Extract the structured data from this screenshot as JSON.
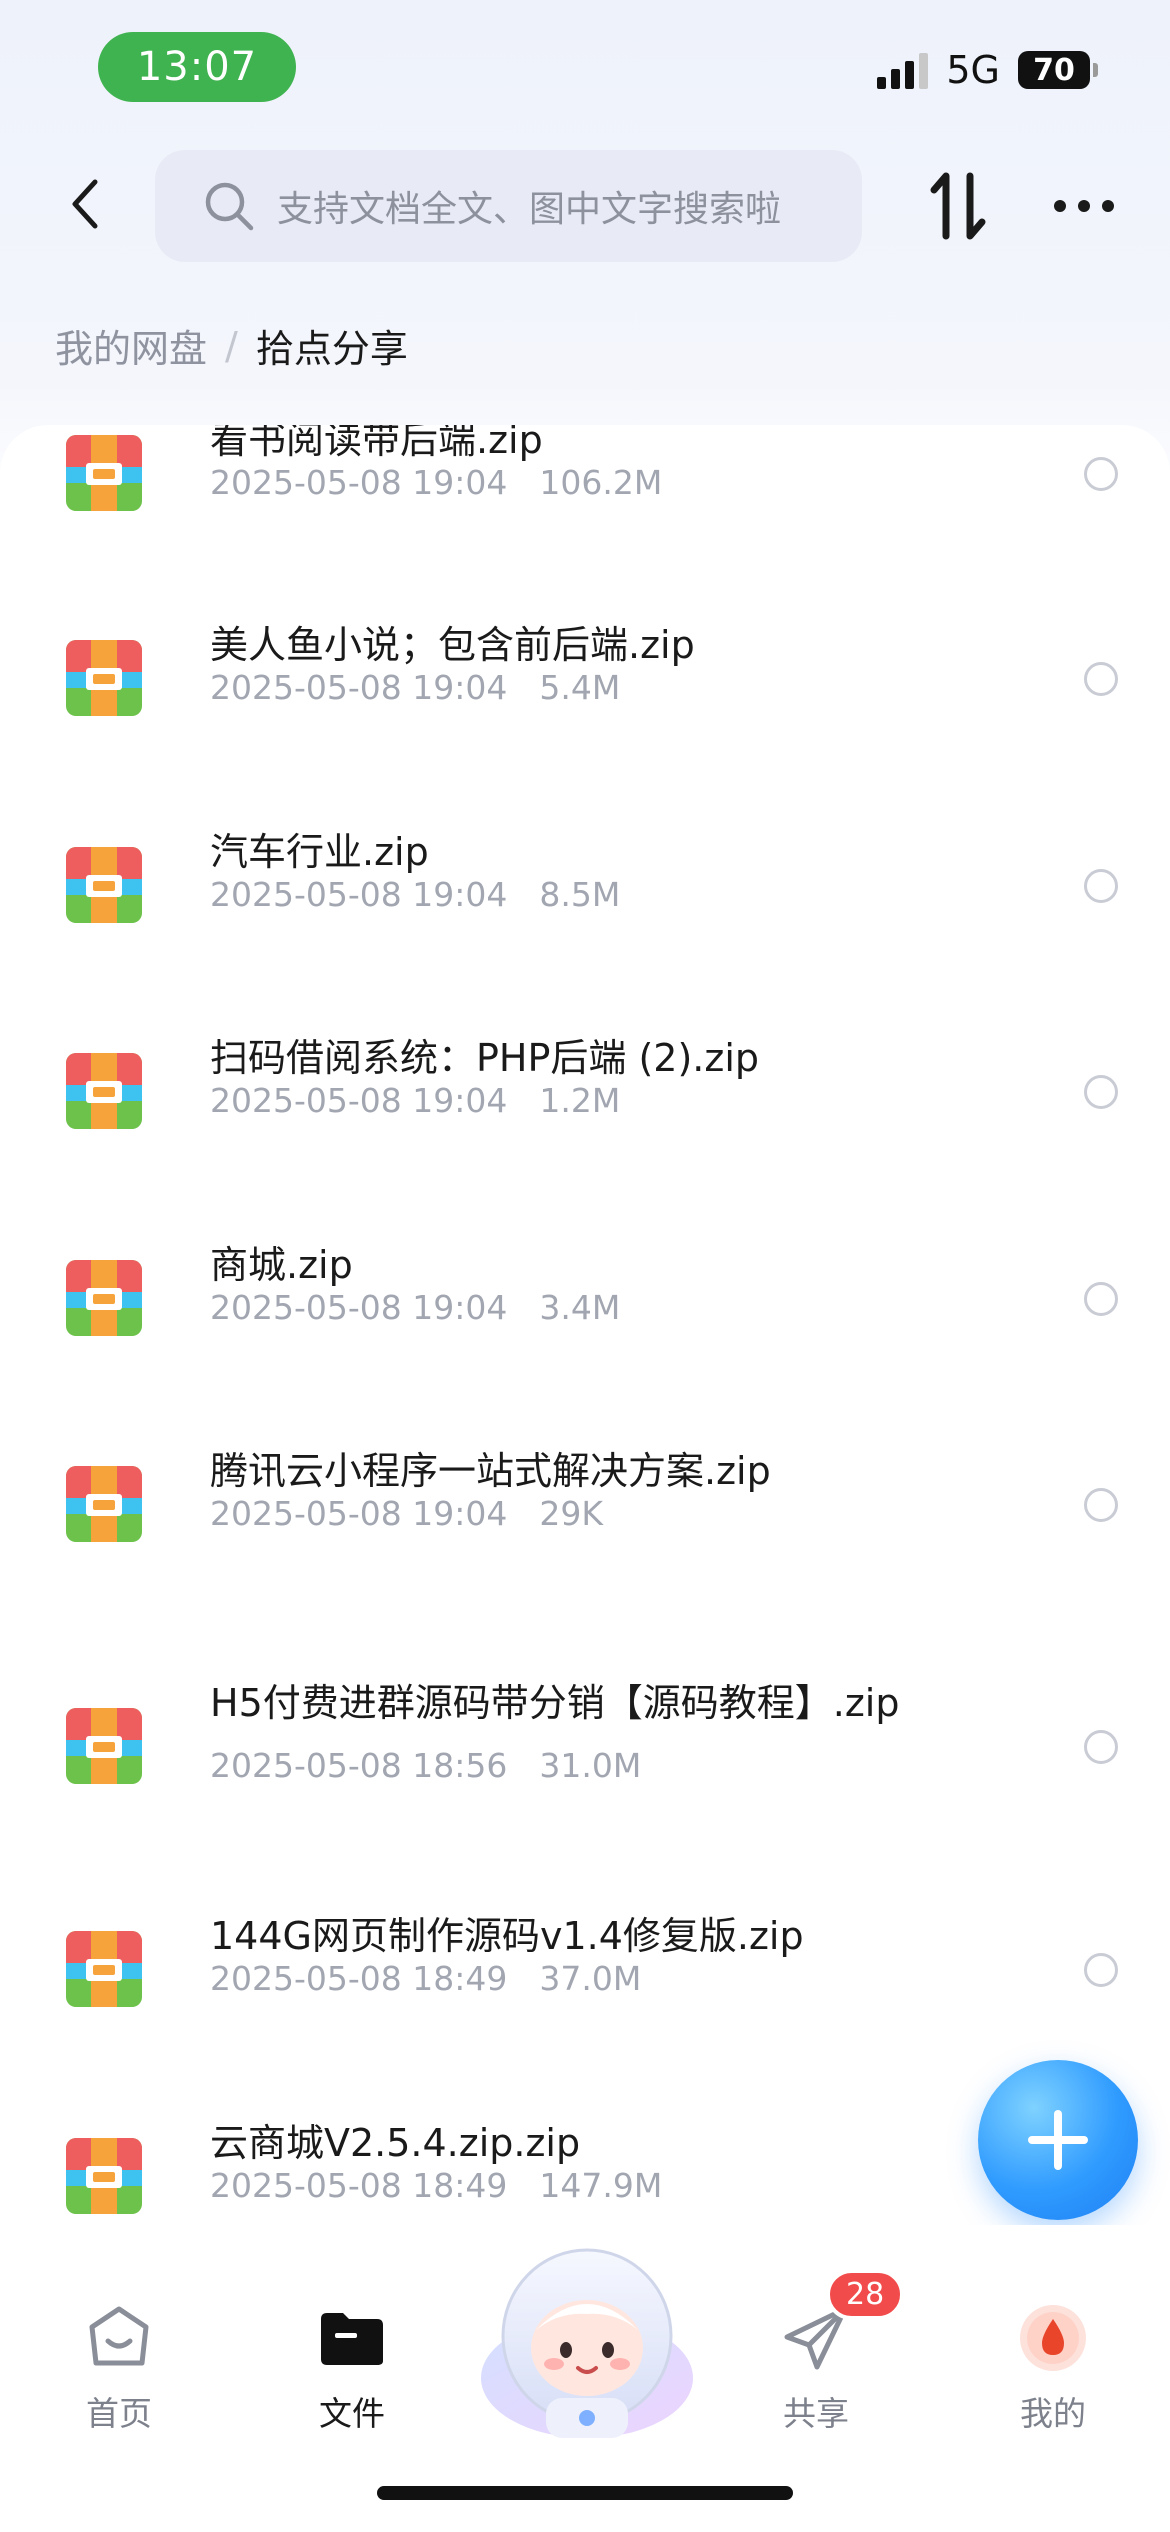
{
  "status_bar": {
    "time": "13:07",
    "network": "5G",
    "battery": "70"
  },
  "header": {
    "search_placeholder": "支持文档全文、图中文字搜索啦"
  },
  "breadcrumb": {
    "root": "我的网盘",
    "separator": "/",
    "current": "拾点分享"
  },
  "files": [
    {
      "name": "看书阅读带后端.zip",
      "date": "2025-05-08 19:04",
      "size": "106.2M"
    },
    {
      "name": "美人鱼小说；包含前后端.zip",
      "date": "2025-05-08 19:04",
      "size": "5.4M"
    },
    {
      "name": "汽车行业.zip",
      "date": "2025-05-08 19:04",
      "size": "8.5M"
    },
    {
      "name": "扫码借阅系统：PHP后端 (2).zip",
      "date": "2025-05-08 19:04",
      "size": "1.2M"
    },
    {
      "name": "商城.zip",
      "date": "2025-05-08 19:04",
      "size": "3.4M"
    },
    {
      "name": "腾讯云小程序一站式解决方案.zip",
      "date": "2025-05-08 19:04",
      "size": "29K"
    },
    {
      "name": "H5付费进群源码带分销【源码教程】.zip",
      "date": "2025-05-08 18:56",
      "size": "31.0M"
    },
    {
      "name": "144G网页制作源码v1.4修复版.zip",
      "date": "2025-05-08 18:49",
      "size": "37.0M"
    },
    {
      "name": "云商城V2.5.4.zip.zip",
      "date": "2025-05-08 18:49",
      "size": "147.9M"
    }
  ],
  "tabbar": {
    "home": "首页",
    "files": "文件",
    "share": "共享",
    "share_badge": "28",
    "me": "我的"
  },
  "colors": {
    "accent_blue": "#2f9bff",
    "status_green": "#3fb34f",
    "badge_red": "#f24b4b"
  }
}
